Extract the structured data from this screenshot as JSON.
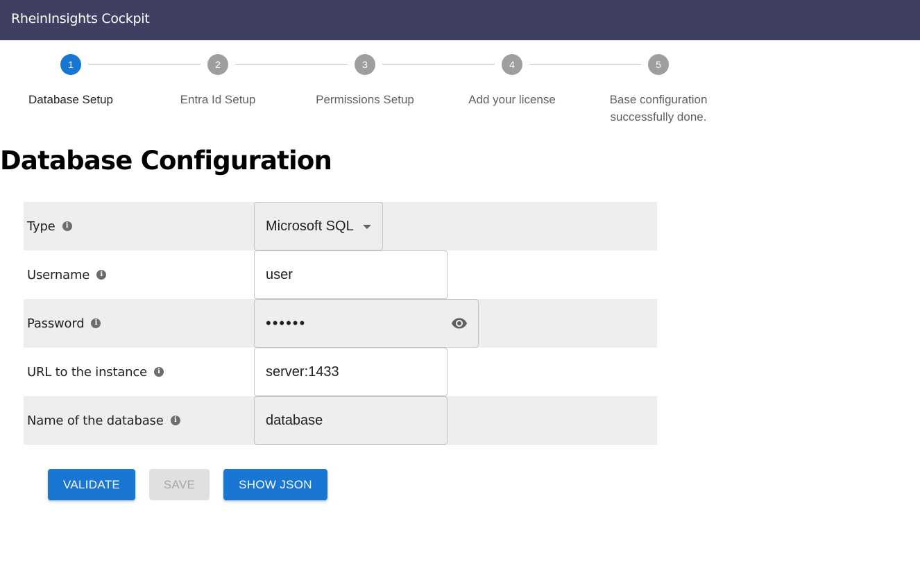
{
  "app": {
    "title": "RheinInsights Cockpit"
  },
  "stepper": {
    "steps": [
      {
        "number": "1",
        "label": "Database Setup",
        "active": true
      },
      {
        "number": "2",
        "label": "Entra Id Setup",
        "active": false
      },
      {
        "number": "3",
        "label": "Permissions Setup",
        "active": false
      },
      {
        "number": "4",
        "label": "Add your license",
        "active": false
      },
      {
        "number": "5",
        "label_line1": "Base configuration",
        "label_line2": "successfully done.",
        "active": false
      }
    ]
  },
  "page": {
    "title": "Database Configuration"
  },
  "form": {
    "type": {
      "label": "Type",
      "value": "Microsoft SQL",
      "info_icon": "info-icon"
    },
    "username": {
      "label": "Username",
      "value": "user",
      "info_icon": "info-icon"
    },
    "password": {
      "label": "Password",
      "value": "••••••",
      "toggle_icon": "eye-icon",
      "info_icon": "info-icon"
    },
    "url": {
      "label": "URL to the instance",
      "value": "server:1433",
      "info_icon": "info-icon"
    },
    "database": {
      "label": "Name of the database",
      "value": "database",
      "info_icon": "info-icon"
    }
  },
  "actions": {
    "validate_label": "VALIDATE",
    "save_label": "SAVE",
    "show_json_label": "SHOW JSON"
  },
  "colors": {
    "appbar": "#3f4061",
    "primary": "#1976d2",
    "step_inactive": "#9e9e9e",
    "row_shade": "#eeeeee"
  }
}
